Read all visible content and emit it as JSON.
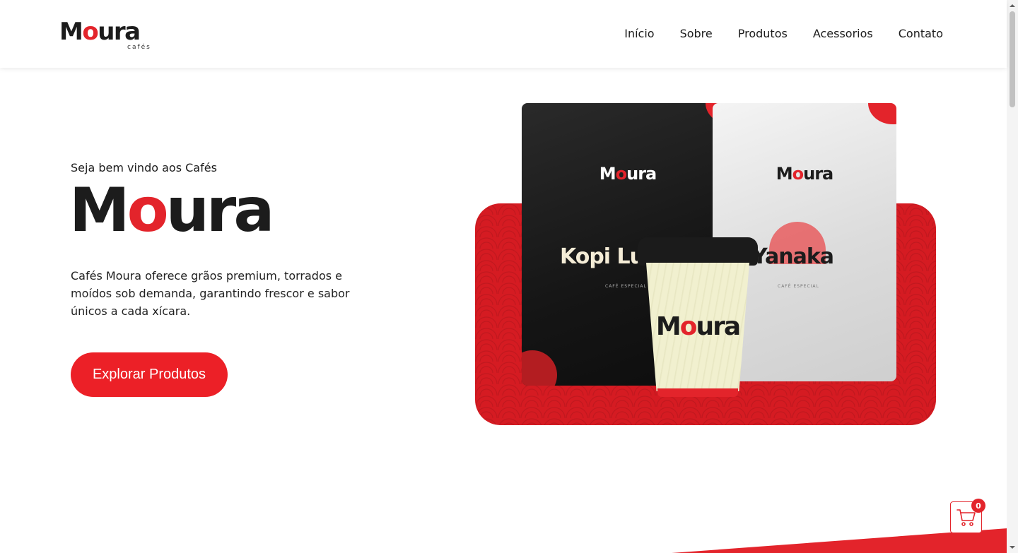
{
  "brand": {
    "name_prefix": "M",
    "name_o": "o",
    "name_suffix": "ura",
    "subtitle": "cafés",
    "accent_color": "#e3242b"
  },
  "nav": {
    "items": [
      {
        "label": "Início"
      },
      {
        "label": "Sobre"
      },
      {
        "label": "Produtos"
      },
      {
        "label": "Acessorios"
      },
      {
        "label": "Contato"
      }
    ]
  },
  "hero": {
    "welcome": "Seja bem vindo aos Cafés",
    "title_prefix": "M",
    "title_o": "o",
    "title_suffix": "ura",
    "description": "Cafés Moura oferece grãos premium, torrados e moídos sob demanda, garantindo frescor e sabor únicos a cada xícara.",
    "cta_label": "Explorar Produtos"
  },
  "product_image": {
    "bag_black_brand_prefix": "M",
    "bag_black_brand_o": "o",
    "bag_black_brand_suffix": "ura",
    "bag_black_name": "Kopi Lu",
    "bag_black_small": "CAFÉ ESPECIAL",
    "bag_white_brand_prefix": "M",
    "bag_white_brand_o": "o",
    "bag_white_brand_suffix": "ura",
    "bag_white_name": "Yanaka",
    "bag_white_small": "CAFÉ ESPECIAL",
    "cup_brand_prefix": "M",
    "cup_brand_o": "o",
    "cup_brand_suffix": "ura"
  },
  "cart": {
    "icon": "cart-icon",
    "count": "0"
  }
}
